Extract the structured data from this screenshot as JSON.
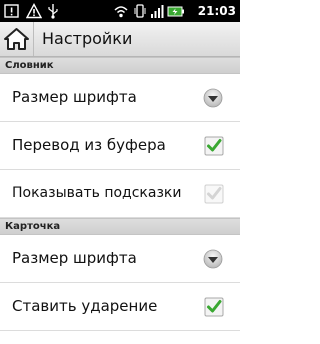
{
  "status_bar": {
    "time": "21:03"
  },
  "title_bar": {
    "title": "Настройки"
  },
  "categories": [
    {
      "label": "Словник"
    },
    {
      "label": "Карточка"
    }
  ],
  "settings": [
    {
      "label": "Размер шрифта",
      "control": "dropdown"
    },
    {
      "label": "Перевод из буфера",
      "control": "checkbox",
      "checked": true,
      "enabled": true
    },
    {
      "label": "Показывать подсказки",
      "control": "checkbox",
      "checked": true,
      "enabled": false
    },
    {
      "label": "Размер шрифта",
      "control": "dropdown"
    },
    {
      "label": "Ставить ударение",
      "control": "checkbox",
      "checked": true,
      "enabled": true
    }
  ],
  "colors": {
    "check_green": "#3aa832",
    "title_gradient_top": "#f2f2f2",
    "category_bg": "#d6d6d6"
  }
}
